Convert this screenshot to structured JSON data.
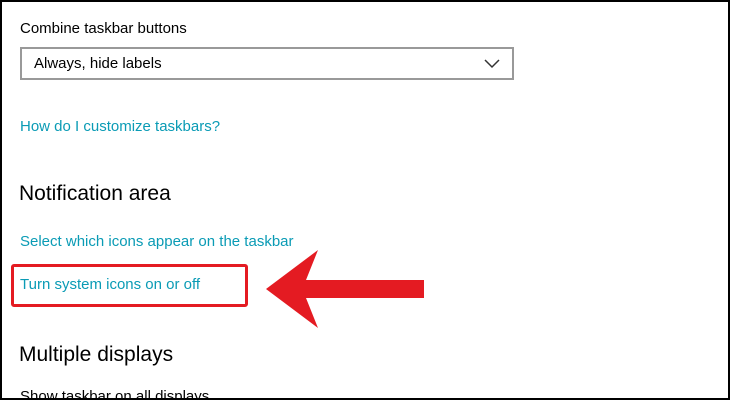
{
  "taskbar": {
    "combine_label": "Combine taskbar buttons",
    "combine_value": "Always, hide labels",
    "help_link": "How do I customize taskbars?"
  },
  "notification_area": {
    "heading": "Notification area",
    "select_icons_link": "Select which icons appear on the taskbar",
    "system_icons_link": "Turn system icons on or off"
  },
  "multiple_displays": {
    "heading": "Multiple displays",
    "partial_text": "Show taskbar on all displays"
  },
  "icons": {
    "dropdown": "chevron-down-icon",
    "annotation": "red-arrow-icon"
  },
  "colors": {
    "link": "#0a9bb5",
    "highlight": "#e41b22"
  }
}
